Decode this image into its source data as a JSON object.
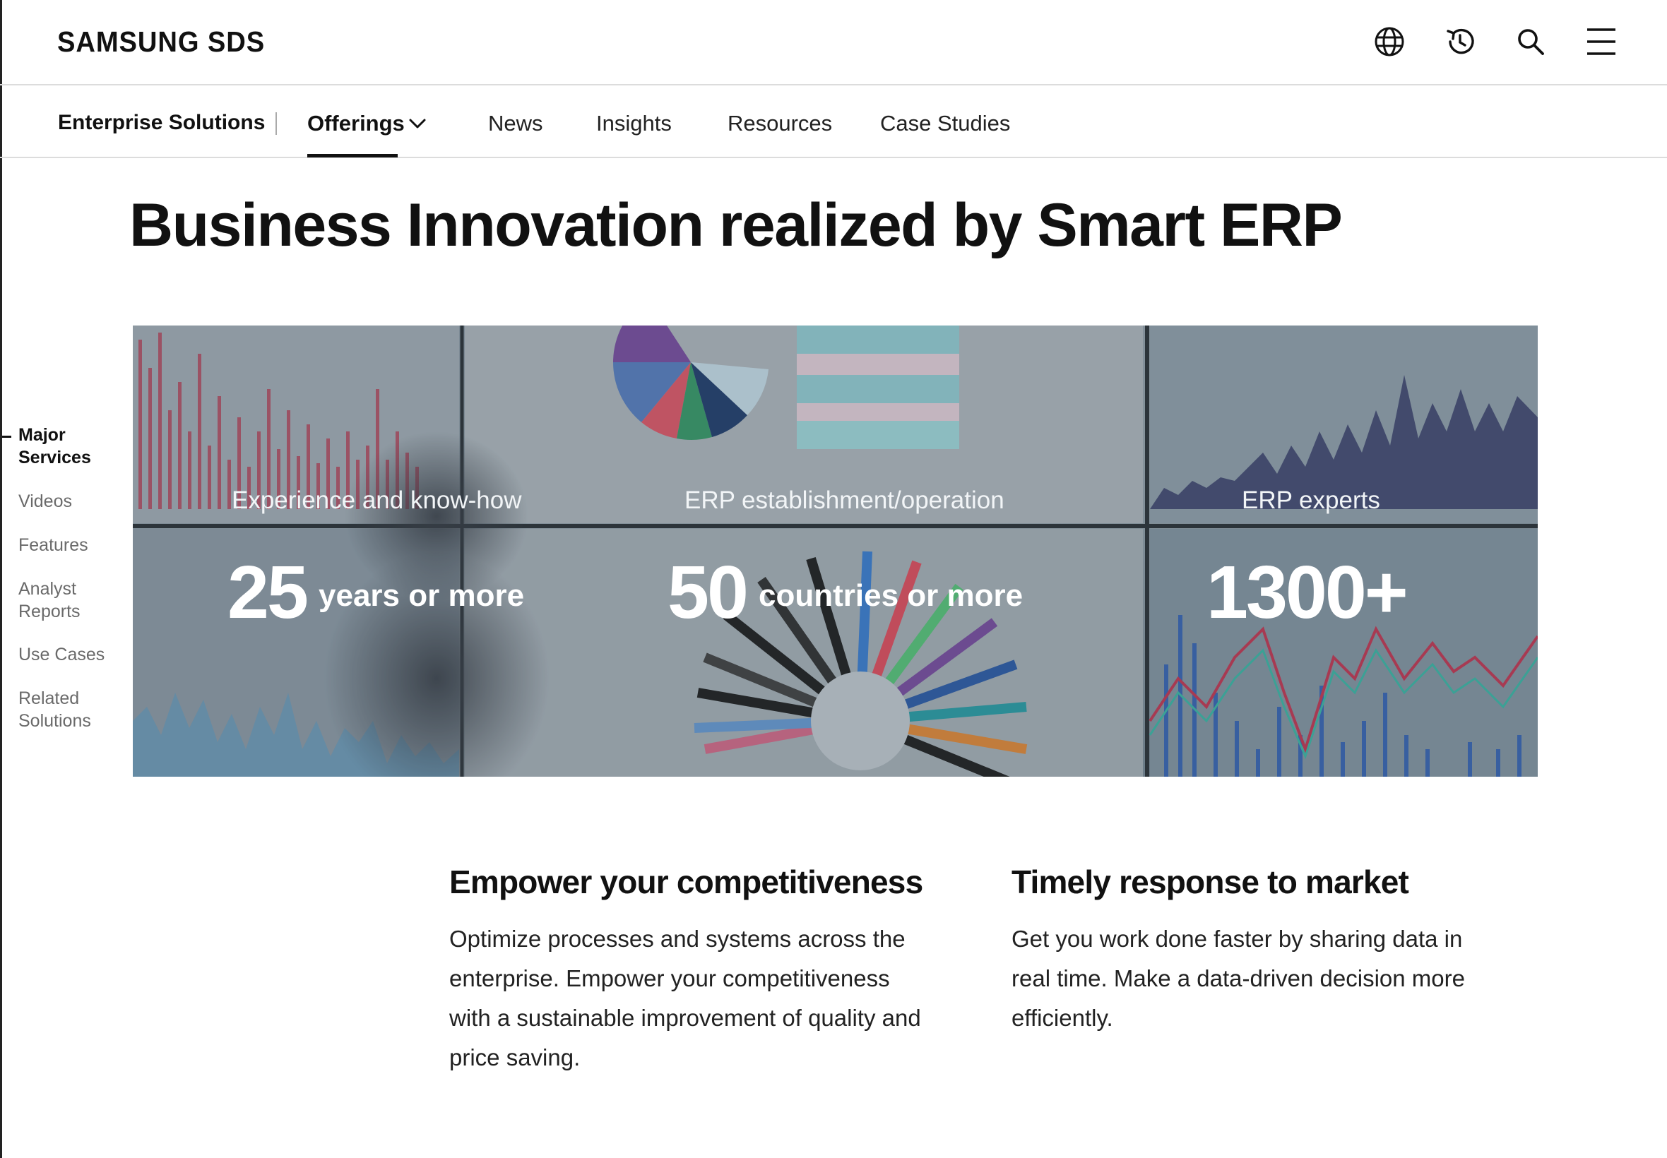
{
  "header": {
    "logo": "SAMSUNG SDS",
    "icons": [
      "globe-icon",
      "history-icon",
      "search-icon",
      "menu-icon"
    ]
  },
  "subnav": {
    "brand": "Enterprise Solutions",
    "items": [
      {
        "label": "Offerings",
        "active": true,
        "has_dropdown": true
      },
      {
        "label": "News"
      },
      {
        "label": "Insights"
      },
      {
        "label": "Resources"
      },
      {
        "label": "Case Studies"
      }
    ]
  },
  "page": {
    "title": "Business Innovation realized by Smart ERP"
  },
  "sidenav": {
    "items": [
      {
        "label": "Major Services",
        "active": true
      },
      {
        "label": "Videos"
      },
      {
        "label": "Features"
      },
      {
        "label": "Analyst Reports"
      },
      {
        "label": "Use Cases"
      },
      {
        "label": "Related Solutions"
      }
    ]
  },
  "hero": {
    "stats": [
      {
        "caption": "Experience and know-how",
        "value": "25",
        "unit": "years or more"
      },
      {
        "caption": "ERP establishment/operation",
        "value": "50",
        "unit": "countries or more"
      },
      {
        "caption": "ERP experts",
        "value": "1300+",
        "unit": ""
      }
    ]
  },
  "features": [
    {
      "title": "Empower your competitiveness",
      "body": "Optimize processes and systems across the enterprise. Empower your competitiveness with a sustainable improvement of quality and price saving."
    },
    {
      "title": "Timely response to market",
      "body": "Get you work done faster by sharing data in real time. Make a data-driven decision more efficiently."
    }
  ]
}
